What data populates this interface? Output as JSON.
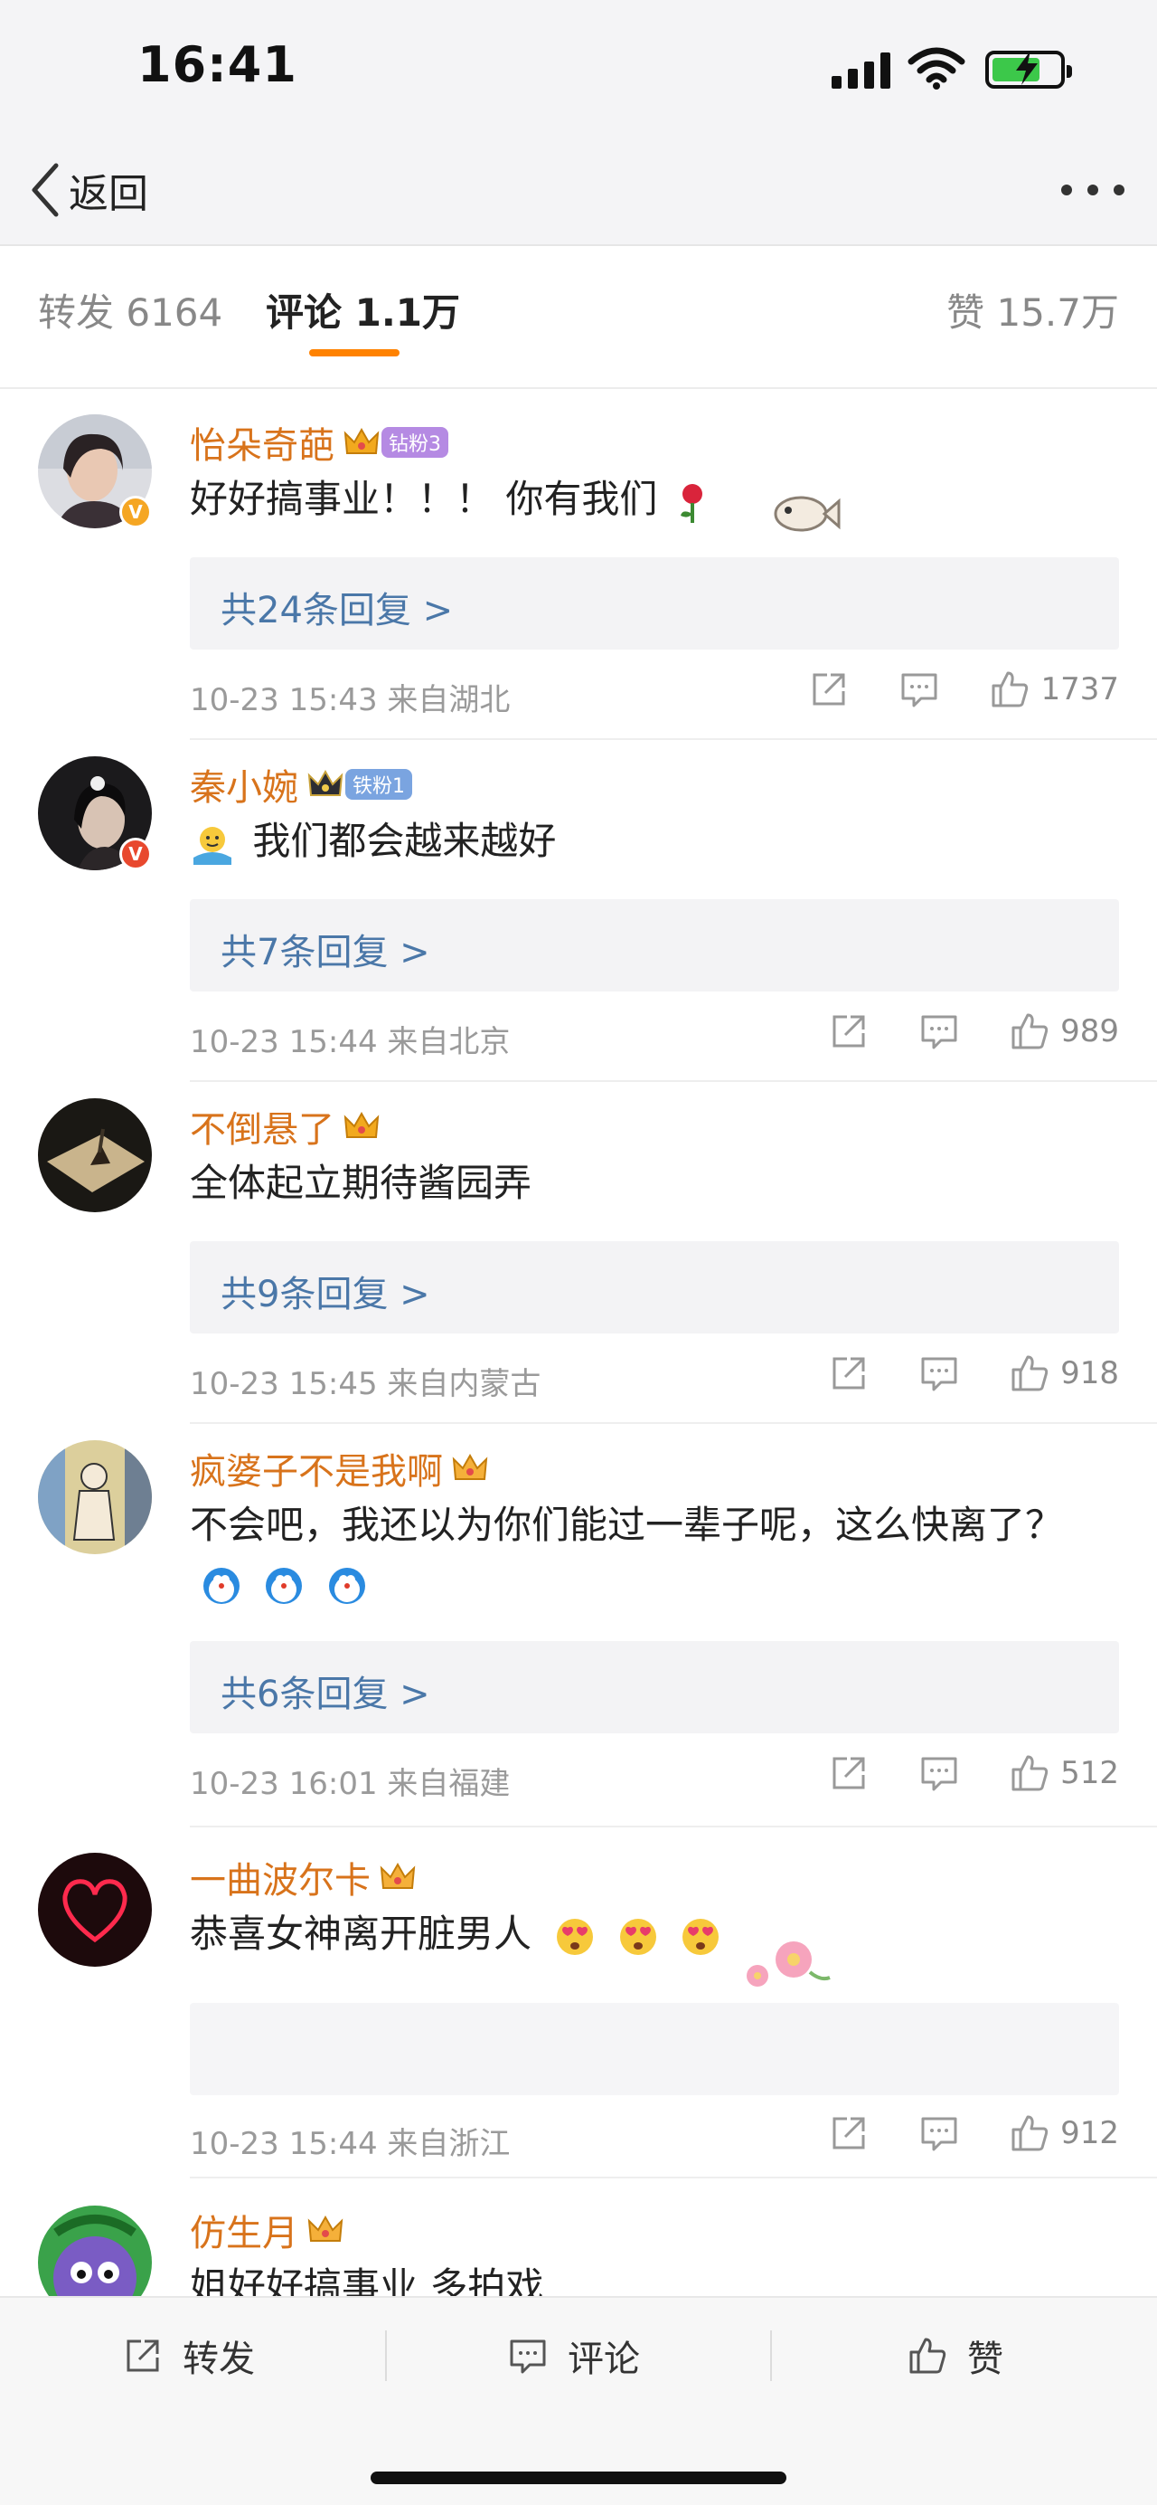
{
  "status_bar": {
    "time": "16:41"
  },
  "nav": {
    "back_label": "返回"
  },
  "tabs": [
    {
      "label": "转发 6164"
    },
    {
      "label": "评论 1.1万"
    },
    {
      "label": "赞 15.7万"
    }
  ],
  "comments": [
    {
      "username": "怡朵奇葩",
      "fan_badge": "钻粉3",
      "text": "好好搞事业！！！ 你有我们",
      "replies": "共24条回复 >",
      "meta": "10-23 15:43 来自湖北",
      "likes": "1737"
    },
    {
      "username": "秦小婉",
      "fan_badge": "铁粉1",
      "text": "我们都会越来越好",
      "replies": "共7条回复 >",
      "meta": "10-23 15:44 来自北京",
      "likes": "989"
    },
    {
      "username": "不倒悬了",
      "text": "全体起立期待酱园弄",
      "replies": "共9条回复 >",
      "meta": "10-23 15:45 来自内蒙古",
      "likes": "918"
    },
    {
      "username": "疯婆子不是我啊",
      "text": "不会吧，我还以为你们能过一辈子呢，这么快离了？",
      "replies": "共6条回复 >",
      "meta": "10-23 16:01 来自福建",
      "likes": "512"
    },
    {
      "username": "一曲波尔卡",
      "text": "恭喜女神离开脏男人",
      "meta": "10-23 15:44 来自浙江",
      "likes": "912"
    },
    {
      "username": "仿生月",
      "text": "姐好好搞事业 多拍戏"
    }
  ],
  "bottom_bar": {
    "repost": "转发",
    "comment": "评论",
    "like": "赞"
  },
  "colors": {
    "accent": "#ff8200",
    "username": "#d8731b",
    "link": "#4a77a8"
  }
}
